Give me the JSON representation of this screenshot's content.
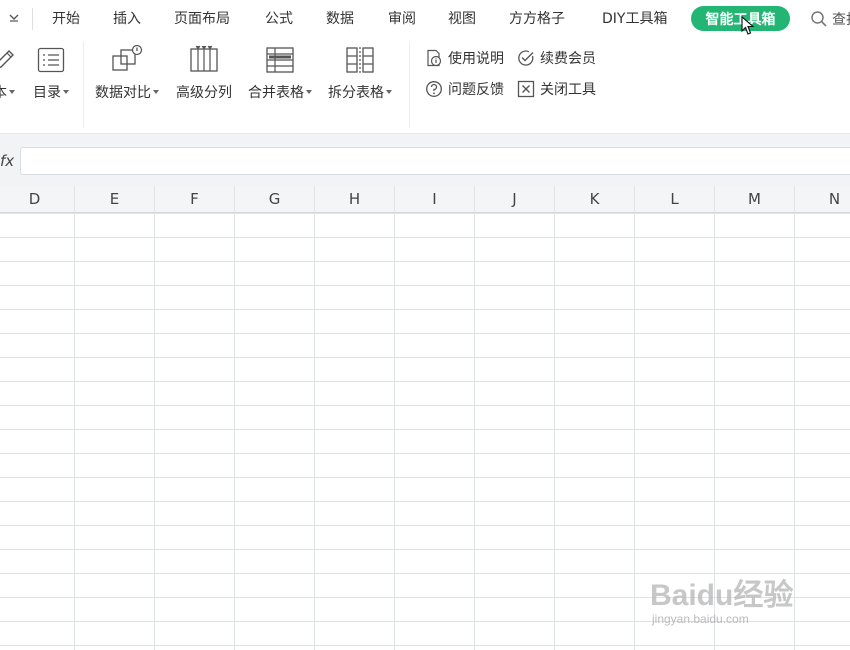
{
  "menubar": {
    "toggle_icon": "chevron-down-icon",
    "tabs": [
      {
        "label": "开始"
      },
      {
        "label": "插入"
      },
      {
        "label": "页面布局"
      },
      {
        "label": "公式"
      },
      {
        "label": "数据"
      },
      {
        "label": "审阅"
      },
      {
        "label": "视图"
      },
      {
        "label": "方方格子"
      },
      {
        "label": "DIY工具箱"
      }
    ],
    "active_tab": {
      "label": "智能工具箱"
    },
    "search": {
      "label": "查找",
      "icon": "search-icon"
    },
    "accent_color": "#22b573"
  },
  "ribbon": {
    "partial_label": "本",
    "catalog": {
      "label": "目录"
    },
    "groups": [
      {
        "label": "数据对比",
        "icon": "data-compare-icon"
      },
      {
        "label": "高级分列",
        "icon": "split-columns-icon"
      },
      {
        "label": "合并表格",
        "icon": "merge-tables-icon"
      },
      {
        "label": "拆分表格",
        "icon": "split-table-icon"
      }
    ],
    "small_buttons": [
      {
        "label": "使用说明",
        "icon": "info-doc-icon"
      },
      {
        "label": "续费会员",
        "icon": "check-circle-icon"
      },
      {
        "label": "问题反馈",
        "icon": "question-circle-icon"
      },
      {
        "label": "关闭工具",
        "icon": "close-box-icon"
      }
    ]
  },
  "formula_bar": {
    "fx_label": "fx",
    "value": ""
  },
  "sheet": {
    "columns": [
      "D",
      "E",
      "F",
      "G",
      "H",
      "I",
      "J",
      "K",
      "L",
      "M",
      "N"
    ]
  },
  "watermark": {
    "logo": "Baidu经验",
    "url": "jingyan.baidu.com"
  }
}
